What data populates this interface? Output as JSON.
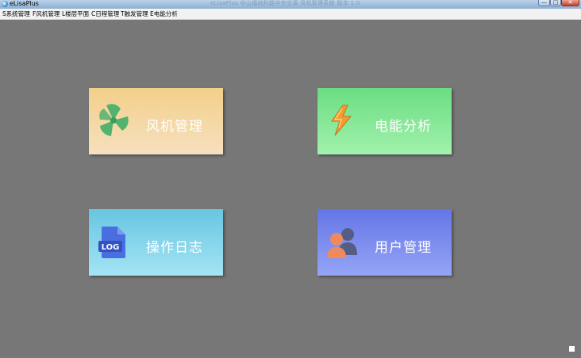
{
  "window": {
    "title": "eLisaPlus",
    "caption": "eLisaPlus 中山福地利能中央空调 风机管理系统 版本 1.0",
    "controls": {
      "minimize": "—",
      "maximize": "□",
      "close": "✕"
    }
  },
  "menu": {
    "items": [
      {
        "label": "S系统管理"
      },
      {
        "label": "F风机管理"
      },
      {
        "label": "L楼层平面"
      },
      {
        "label": "C日程管理"
      },
      {
        "label": "T触发管理"
      },
      {
        "label": "E电能分析"
      }
    ]
  },
  "tiles": {
    "fan": {
      "label": "风机管理",
      "icon": "fan-icon"
    },
    "energy": {
      "label": "电能分析",
      "icon": "lightning-bolt-icon"
    },
    "log": {
      "label": "操作日志",
      "icon": "log-file-icon",
      "icon_text": "LOG"
    },
    "user": {
      "label": "用户管理",
      "icon": "users-icon"
    }
  },
  "colors": {
    "background": "#777777",
    "fan_tile": "#f4cf8a",
    "energy_tile": "#6bdd82",
    "log_tile": "#67c6e1",
    "user_tile": "#6476e6"
  }
}
